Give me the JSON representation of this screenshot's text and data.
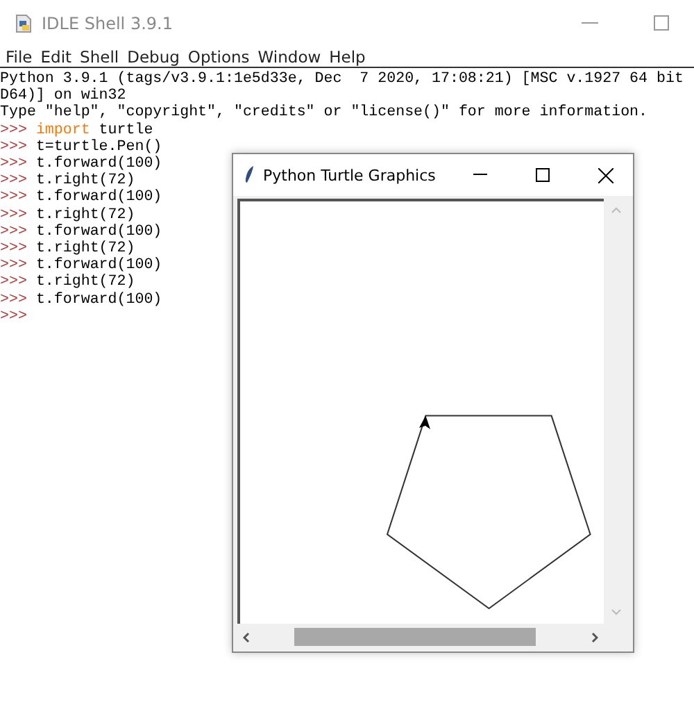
{
  "shell": {
    "title": "IDLE Shell 3.9.1",
    "menu": [
      "File",
      "Edit",
      "Shell",
      "Debug",
      "Options",
      "Window",
      "Help"
    ],
    "output": [
      "Python 3.9.1 (tags/v3.9.1:1e5d33e, Dec  7 2020, 17:08:21) [MSC v.1927 64 bit",
      "D64)] on win32",
      "Type \"help\", \"copyright\", \"credits\" or \"license()\" for more information."
    ],
    "history": [
      {
        "prompt": ">>>",
        "code": [
          {
            "kind": "keyword",
            "text": "import"
          },
          {
            "kind": "plain",
            "text": " turtle"
          }
        ]
      },
      {
        "prompt": ">>>",
        "code": [
          {
            "kind": "plain",
            "text": "t=turtle.Pen()"
          }
        ]
      },
      {
        "prompt": ">>>",
        "code": [
          {
            "kind": "plain",
            "text": "t.forward(100)"
          }
        ]
      },
      {
        "prompt": ">>>",
        "code": [
          {
            "kind": "plain",
            "text": "t.right(72)"
          }
        ]
      },
      {
        "prompt": ">>>",
        "code": [
          {
            "kind": "plain",
            "text": "t.forward(100)"
          }
        ]
      },
      {
        "prompt": ">>>",
        "code": [
          {
            "kind": "plain",
            "text": "t.right(72)"
          }
        ]
      },
      {
        "prompt": ">>>",
        "code": [
          {
            "kind": "plain",
            "text": "t.forward(100)"
          }
        ]
      },
      {
        "prompt": ">>>",
        "code": [
          {
            "kind": "plain",
            "text": "t.right(72)"
          }
        ]
      },
      {
        "prompt": ">>>",
        "code": [
          {
            "kind": "plain",
            "text": "t.forward(100)"
          }
        ]
      },
      {
        "prompt": ">>>",
        "code": [
          {
            "kind": "plain",
            "text": "t.right(72)"
          }
        ]
      },
      {
        "prompt": ">>>",
        "code": [
          {
            "kind": "plain",
            "text": "t.forward(100)"
          }
        ]
      },
      {
        "prompt": ">>>"
      }
    ]
  },
  "turtle_window": {
    "title": "Python Turtle Graphics"
  }
}
